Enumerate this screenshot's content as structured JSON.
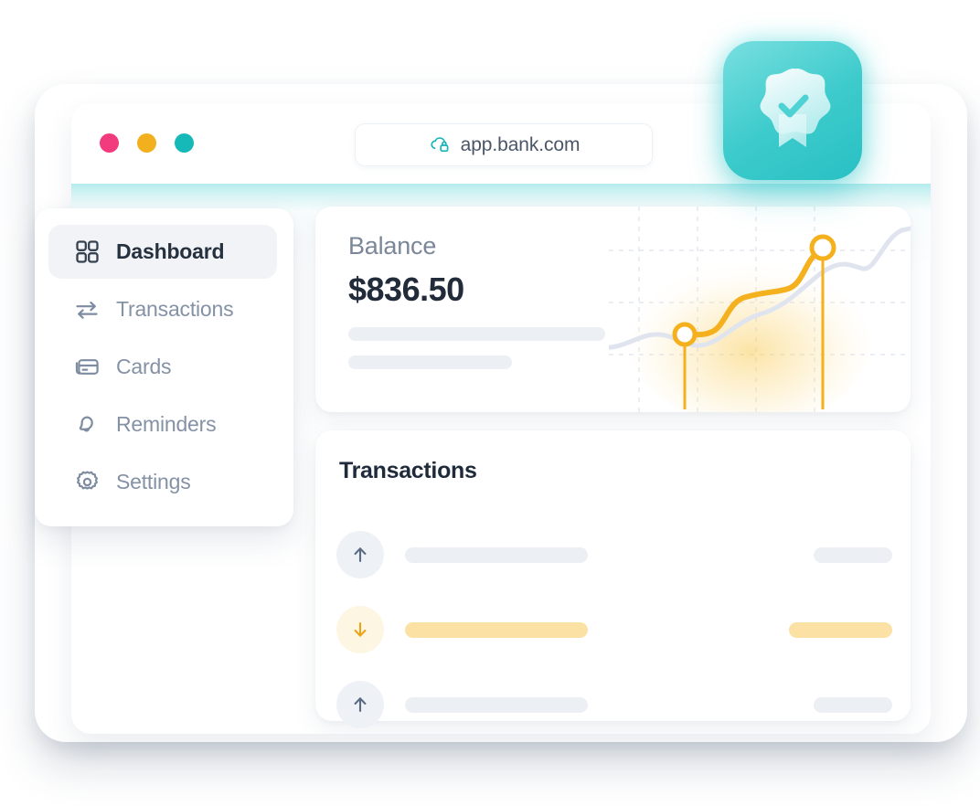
{
  "browser": {
    "traffic_lights": [
      {
        "name": "close-dot",
        "color": "#f23a7e"
      },
      {
        "name": "minimize-dot",
        "color": "#f2b01e"
      },
      {
        "name": "maximize-dot",
        "color": "#16b8b8"
      }
    ],
    "url": "app.bank.com",
    "url_icon": "cloud-lock-icon"
  },
  "badge": {
    "icon": "verified-award-icon",
    "background_color": "#3ecbcc"
  },
  "sidebar": {
    "items": [
      {
        "label": "Dashboard",
        "icon": "grid-icon",
        "active": true
      },
      {
        "label": "Transactions",
        "icon": "transfer-icon",
        "active": false
      },
      {
        "label": "Cards",
        "icon": "credit-card-icon",
        "active": false
      },
      {
        "label": "Reminders",
        "icon": "bell-icon",
        "active": false
      },
      {
        "label": "Settings",
        "icon": "gear-icon",
        "active": false
      }
    ]
  },
  "balance": {
    "label": "Balance",
    "amount": "$836.50",
    "accent_color": "#f5a623"
  },
  "transactions": {
    "title": "Transactions",
    "rows": [
      {
        "direction": "up",
        "icon": "arrow-up-icon",
        "highlight": false
      },
      {
        "direction": "down",
        "icon": "arrow-down-icon",
        "highlight": true
      },
      {
        "direction": "up",
        "icon": "arrow-up-icon",
        "highlight": false
      }
    ]
  },
  "chart_data": {
    "type": "line",
    "title": "",
    "xlabel": "",
    "ylabel": "",
    "grid": true,
    "legend": null,
    "series": [
      {
        "name": "balance-trend",
        "color": "#f5b01e",
        "x": [
          0.33,
          0.5,
          0.66,
          0.78
        ],
        "y": [
          0.38,
          0.4,
          0.58,
          0.72
        ]
      },
      {
        "name": "background-trend",
        "color": "#dfe4ee",
        "x": [
          0.0,
          0.14,
          0.28,
          0.45,
          0.62,
          0.8,
          1.0
        ],
        "y": [
          0.22,
          0.24,
          0.33,
          0.38,
          0.5,
          0.72,
          0.8
        ]
      }
    ],
    "markers": [
      {
        "x": 0.33,
        "y": 0.38
      },
      {
        "x": 0.78,
        "y": 0.72
      }
    ],
    "xlim": [
      0,
      1
    ],
    "ylim": [
      0,
      1
    ]
  }
}
